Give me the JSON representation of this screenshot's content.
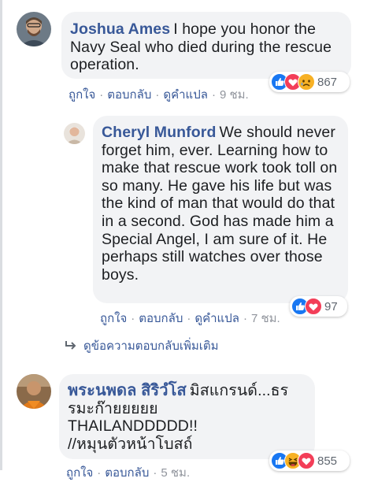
{
  "comments": [
    {
      "author": "Joshua Ames",
      "text": "I hope you honor the Navy Seal who died during the rescue operation.",
      "actions": {
        "like": "ถูกใจ",
        "reply": "ตอบกลับ",
        "translate": "ดูคำแปล",
        "time": "9 ชม."
      },
      "reactions": {
        "icons": [
          "like-icon",
          "love-icon",
          "sad-icon"
        ],
        "count": "867"
      }
    },
    {
      "author": "Cheryl Munford",
      "text": "We should never forget him, ever. Learning how to make that rescue work took toll on so many. He gave his life but was the kind of man that would do that in a second. God has made him a Special Angel, I am sure of it. He perhaps still watches over those boys.",
      "actions": {
        "like": "ถูกใจ",
        "reply": "ตอบกลับ",
        "translate": "ดูคำแปล",
        "time": "7 ชม."
      },
      "reactions": {
        "icons": [
          "like-icon",
          "love-icon"
        ],
        "count": "97"
      }
    },
    {
      "author": "พระนพดล สิริวํโส",
      "text_lines": [
        "มิสแกรนด์...ธร",
        "รมะก๊ายยยยย",
        "THAILANDDDDD!!",
        "//หมุนตัวหน้าโบสถ์"
      ],
      "actions": {
        "like": "ถูกใจ",
        "reply": "ตอบกลับ",
        "time": "5 ชม."
      },
      "reactions": {
        "icons": [
          "like-icon",
          "haha-icon",
          "love-icon"
        ],
        "count": "855"
      }
    }
  ],
  "more_replies": {
    "label": "ดูข้อความตอบกลับเพิ่มเติม"
  },
  "colors": {
    "link": "#385898",
    "like": "#1877f2",
    "love": "#f33e58",
    "emoji": "#f7b125",
    "bubble": "#f2f3f5",
    "meta": "#90949c"
  }
}
